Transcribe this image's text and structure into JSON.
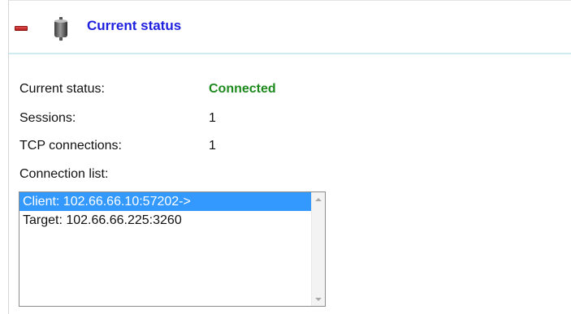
{
  "header": {
    "title": "Current status",
    "collapse_icon": "minus-icon",
    "section_icon": "disk-icon",
    "accent_color": "#1f1fe0"
  },
  "status": {
    "current_status_label": "Current status:",
    "current_status_value": "Connected",
    "current_status_color": "#1d8a1d",
    "sessions_label": "Sessions:",
    "sessions_value": "1",
    "tcp_label": "TCP connections:",
    "tcp_value": "1"
  },
  "connection_list": {
    "label": "Connection list:",
    "items": [
      "Client: 102.66.66.10:57202->",
      "Target: 102.66.66.225:3260"
    ],
    "selected_index": 0,
    "selection_color": "#3399ff"
  }
}
